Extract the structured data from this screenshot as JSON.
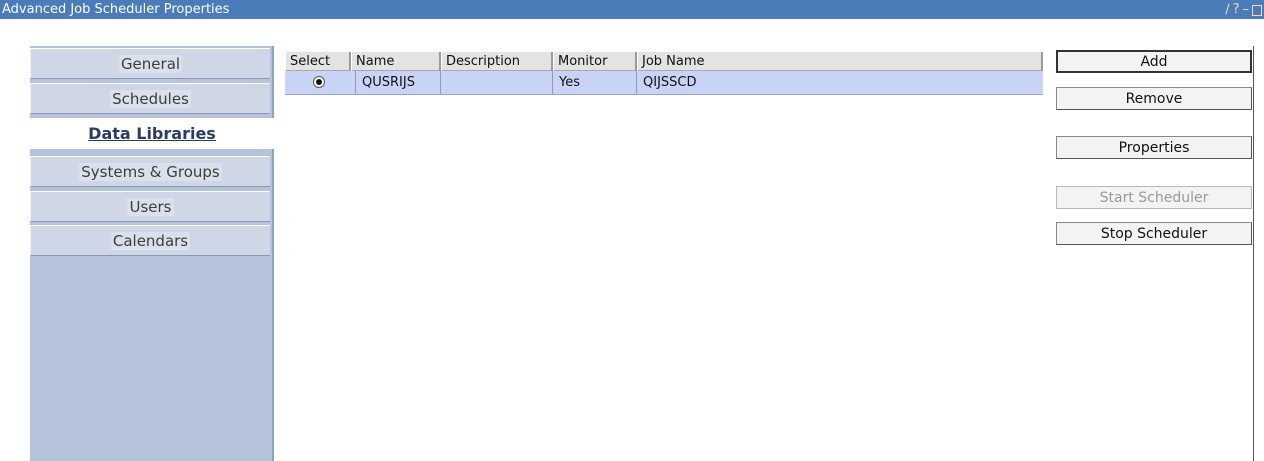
{
  "window": {
    "title": "Advanced Job Scheduler Properties",
    "controls": [
      {
        "name": "edit-icon",
        "glyph": "∕"
      },
      {
        "name": "help-icon",
        "glyph": "?"
      },
      {
        "name": "minimize-icon",
        "glyph": "–"
      }
    ]
  },
  "sidebar": {
    "tabs": [
      {
        "label": "General",
        "active": false
      },
      {
        "label": "Schedules",
        "active": false
      },
      {
        "label": "Data Libraries",
        "active": true
      },
      {
        "label": "Systems & Groups",
        "active": false
      },
      {
        "label": "Users",
        "active": false
      },
      {
        "label": "Calendars",
        "active": false
      }
    ]
  },
  "table": {
    "columns": [
      "Select",
      "Name",
      "Description",
      "Monitor",
      "Job Name"
    ],
    "rows": [
      {
        "selected": true,
        "name": "QUSRIJS",
        "description": "",
        "monitor": "Yes",
        "job_name": "QIJSSCD"
      }
    ]
  },
  "buttons": {
    "add": "Add",
    "remove": "Remove",
    "properties": "Properties",
    "start_scheduler": "Start Scheduler",
    "stop_scheduler": "Stop Scheduler"
  },
  "colors": {
    "titlebar": "#4b7cba",
    "sidebar": "#b5c4dc",
    "selected_row": "#c9d3f5",
    "active_tab_text": "#2a3b66"
  }
}
